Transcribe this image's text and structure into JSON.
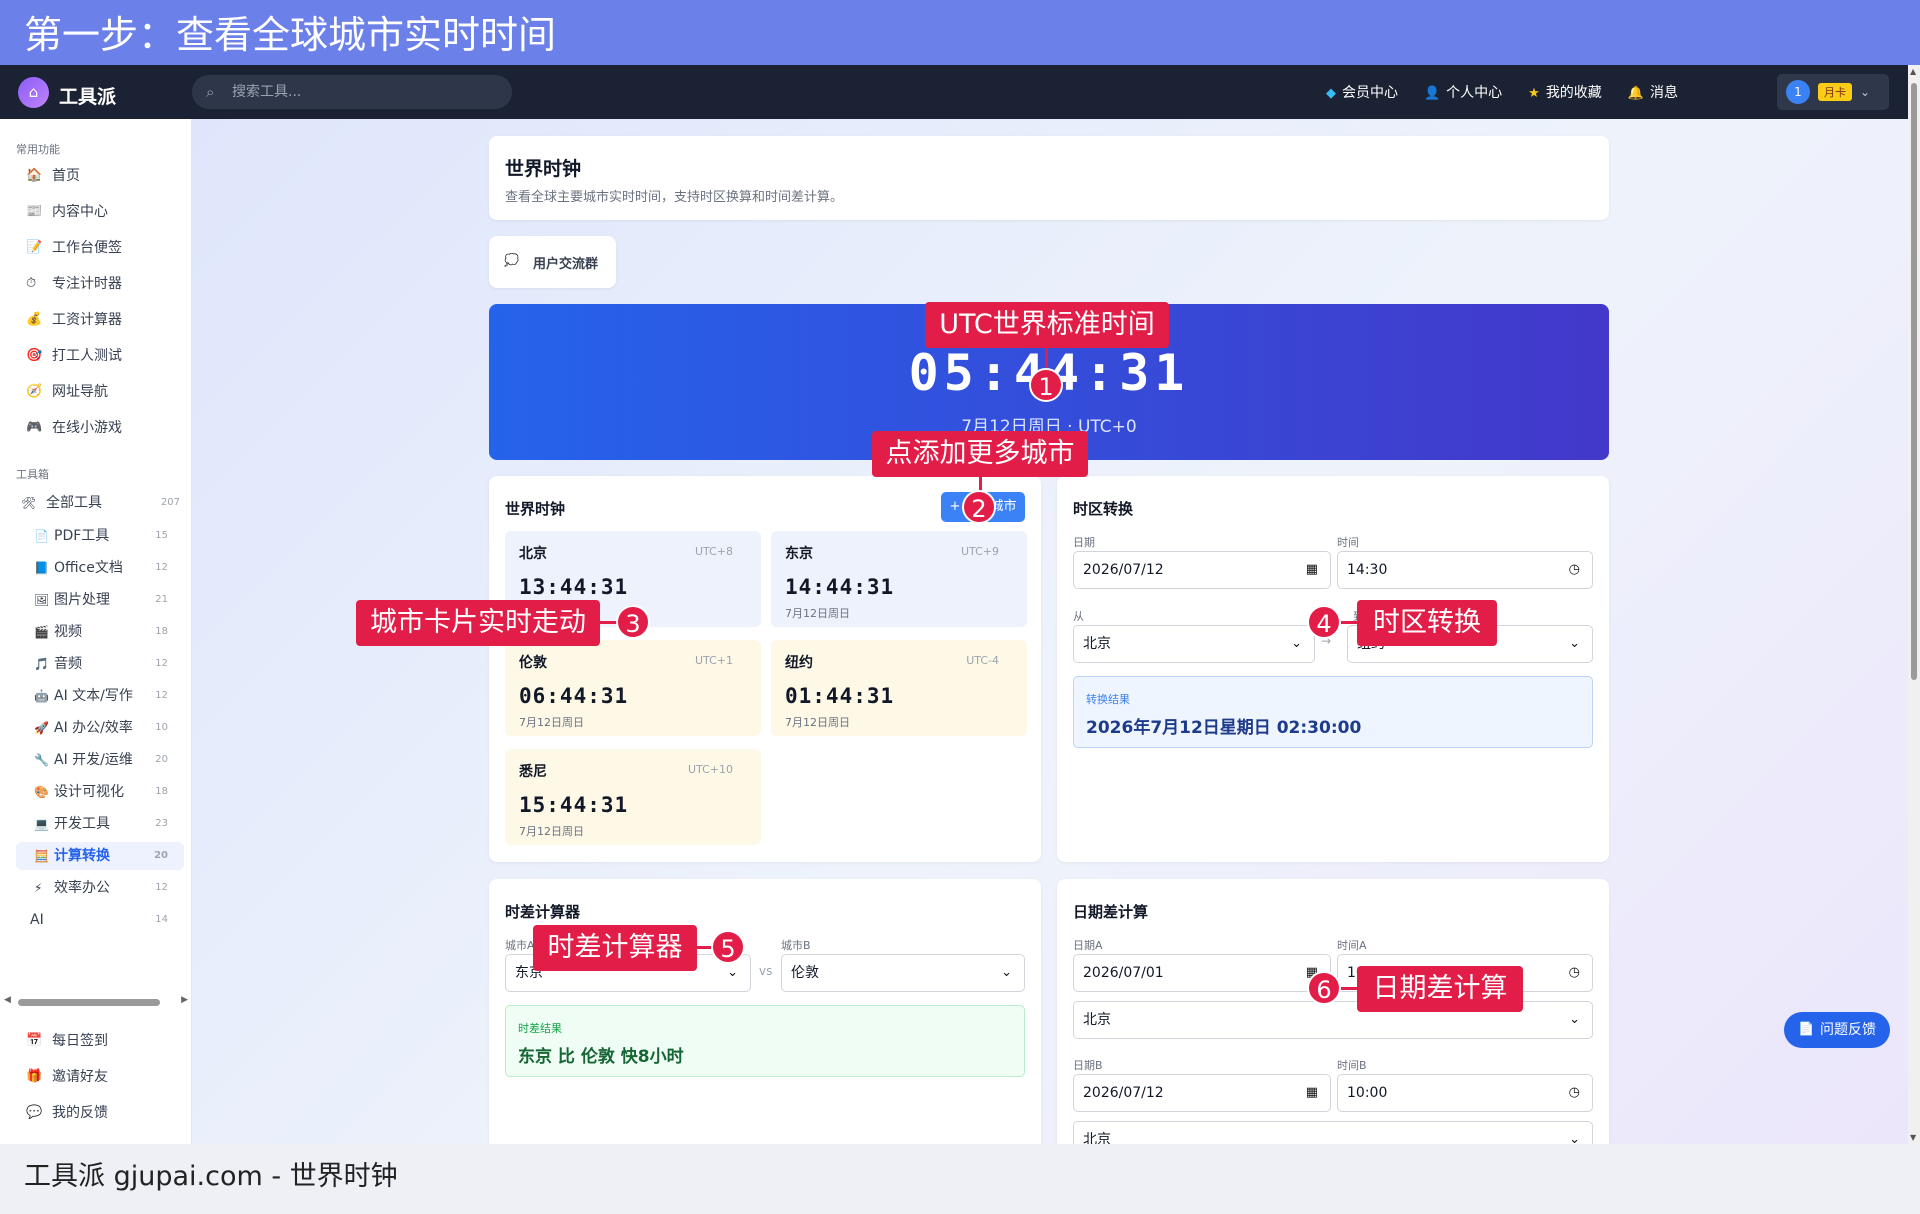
{
  "banner": {
    "title": "第一步：查看全球城市实时时间"
  },
  "nav": {
    "brand": "工具派",
    "search_placeholder": "搜索工具...",
    "links": [
      "会员中心",
      "个人中心",
      "我的收藏",
      "消息"
    ],
    "avatar": "1",
    "card_badge": "月卡"
  },
  "sidebar": {
    "common_title": "常用功能",
    "common": [
      {
        "icon": "🏠",
        "label": "首页"
      },
      {
        "icon": "📰",
        "label": "内容中心"
      },
      {
        "icon": "📝",
        "label": "工作台便签"
      },
      {
        "icon": "⏱",
        "label": "专注计时器"
      },
      {
        "icon": "💰",
        "label": "工资计算器"
      },
      {
        "icon": "🎯",
        "label": "打工人测试"
      },
      {
        "icon": "🧭",
        "label": "网址导航"
      },
      {
        "icon": "🎮",
        "label": "在线小游戏"
      }
    ],
    "tools_title": "工具箱",
    "all_tools": {
      "label": "全部工具",
      "count": "207"
    },
    "categories": [
      {
        "icon": "📄",
        "label": "PDF工具",
        "count": "15"
      },
      {
        "icon": "📘",
        "label": "Office文档",
        "count": "12"
      },
      {
        "icon": "🖼",
        "label": "图片处理",
        "count": "21"
      },
      {
        "icon": "🎬",
        "label": "视频",
        "count": "18"
      },
      {
        "icon": "🎵",
        "label": "音频",
        "count": "12"
      },
      {
        "icon": "🤖",
        "label": "AI 文本/写作",
        "count": "12"
      },
      {
        "icon": "🚀",
        "label": "AI 办公/效率",
        "count": "10"
      },
      {
        "icon": "🔧",
        "label": "AI 开发/运维",
        "count": "20"
      },
      {
        "icon": "🎨",
        "label": "设计可视化",
        "count": "18"
      },
      {
        "icon": "💻",
        "label": "开发工具",
        "count": "23"
      },
      {
        "icon": "🧮",
        "label": "计算转换",
        "count": "20"
      },
      {
        "icon": "⚡",
        "label": "效率办公",
        "count": "12"
      },
      {
        "icon": "",
        "label": "AI",
        "count": "14"
      }
    ],
    "bottom": [
      {
        "icon": "📅",
        "label": "每日签到"
      },
      {
        "icon": "🎁",
        "label": "邀请好友"
      },
      {
        "icon": "💬",
        "label": "我的反馈"
      }
    ]
  },
  "header": {
    "title": "世界时钟",
    "subtitle": "查看全球主要城市实时时间，支持时区换算和时间差计算。"
  },
  "group_btn": "用户交流群",
  "utc": {
    "time": "05:44:31",
    "date": "7月12日周日 · UTC+0"
  },
  "world": {
    "title": "世界时钟",
    "add_label": "+ 添加城市",
    "cities": [
      {
        "name": "北京",
        "tz": "UTC+8",
        "time": "13:44:31",
        "date": "7月12日周日",
        "tone": "blue"
      },
      {
        "name": "东京",
        "tz": "UTC+9",
        "time": "14:44:31",
        "date": "7月12日周日",
        "tone": "blue"
      },
      {
        "name": "伦敦",
        "tz": "UTC+1",
        "time": "06:44:31",
        "date": "7月12日周日",
        "tone": "yellow"
      },
      {
        "name": "纽约",
        "tz": "UTC-4",
        "time": "01:44:31",
        "date": "7月12日周日",
        "tone": "yellow"
      },
      {
        "name": "悉尼",
        "tz": "UTC+10",
        "time": "15:44:31",
        "date": "7月12日周日",
        "tone": "yellow"
      }
    ]
  },
  "convert": {
    "title": "时区转换",
    "date_label": "日期",
    "date": "2026/07/12",
    "time_label": "时间",
    "time": "14:30",
    "from_label": "从",
    "from": "北京",
    "to_label": "到",
    "to": "纽约",
    "result_label": "转换结果",
    "result": "2026年7月12日星期日 02:30:00"
  },
  "diff": {
    "title": "时差计算器",
    "a_label": "城市A",
    "a": "东京",
    "vs": "vs",
    "b_label": "城市B",
    "b": "伦敦",
    "result_label": "时差结果",
    "result": "东京 比 伦敦 快8小时"
  },
  "datediff": {
    "title": "日期差计算",
    "date_a_label": "日期A",
    "date_a": "2026/07/01",
    "time_a_label": "时间A",
    "time_a": "10:00",
    "city_a": "北京",
    "date_b_label": "日期B",
    "date_b": "2026/07/12",
    "time_b_label": "时间B",
    "time_b": "10:00",
    "city_b": "北京"
  },
  "annotations": [
    {
      "n": "1",
      "text": "UTC世界标准时间"
    },
    {
      "n": "2",
      "text": "点添加更多城市"
    },
    {
      "n": "3",
      "text": "城市卡片实时走动"
    },
    {
      "n": "4",
      "text": "时区转换"
    },
    {
      "n": "5",
      "text": "时差计算器"
    },
    {
      "n": "6",
      "text": "日期差计算"
    }
  ],
  "feedback": "问题反馈",
  "footer": "工具派 gjupai.com - 世界时钟"
}
